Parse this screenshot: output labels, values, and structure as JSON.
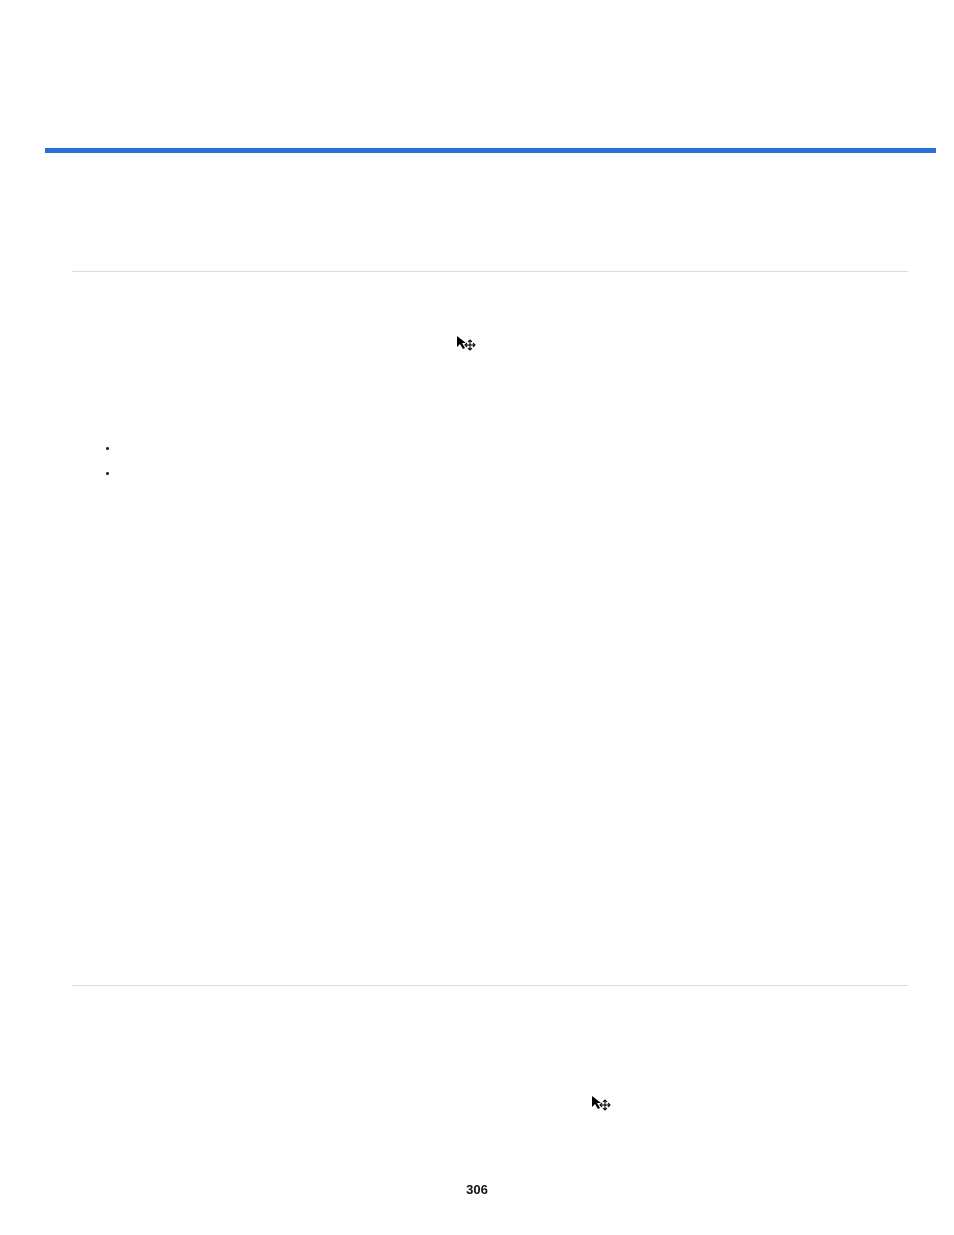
{
  "page_number": "306",
  "icons": {
    "move_cursor_1": "move-cursor-icon",
    "move_cursor_2": "move-cursor-icon"
  }
}
